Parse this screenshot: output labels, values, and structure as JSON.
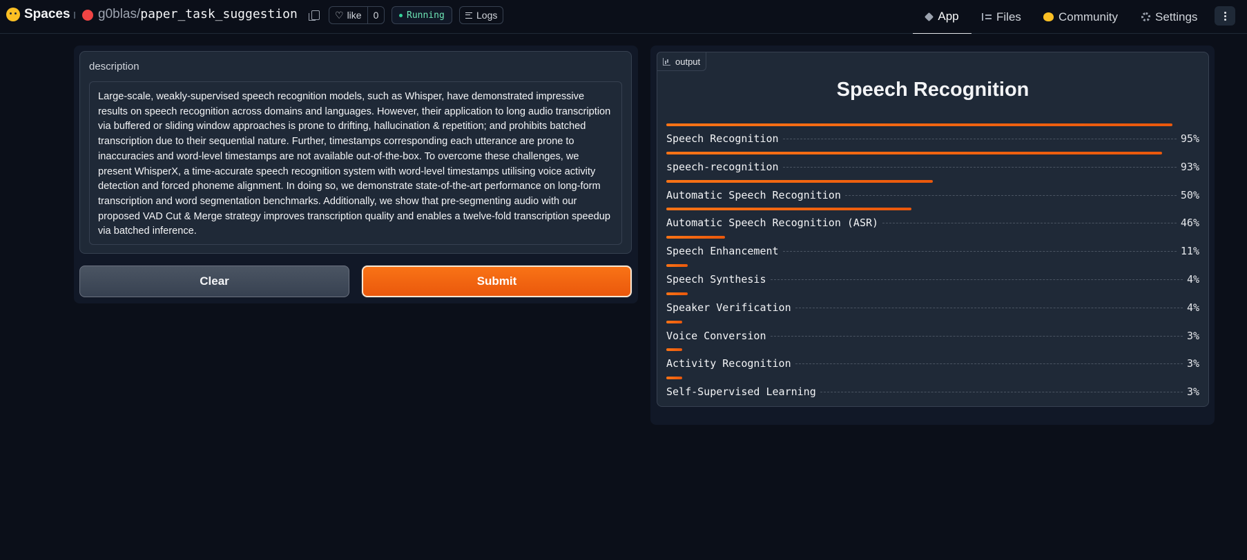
{
  "header": {
    "brand": "Spaces",
    "owner": "g0blas",
    "slash": "/",
    "repo_name": "paper_task_suggestion",
    "like_label": "like",
    "like_count": "0",
    "status": "Running",
    "logs_label": "Logs",
    "nav": {
      "app": "App",
      "files": "Files",
      "community": "Community",
      "settings": "Settings"
    }
  },
  "input": {
    "label": "description",
    "value": "Large-scale, weakly-supervised speech recognition models, such as Whisper, have demonstrated impressive results on speech recognition across domains and languages. However, their application to long audio transcription via buffered or sliding window approaches is prone to drifting, hallucination & repetition; and prohibits batched transcription due to their sequential nature. Further, timestamps corresponding each utterance are prone to inaccuracies and word-level timestamps are not available out-of-the-box. To overcome these challenges, we present WhisperX, a time-accurate speech recognition system with word-level timestamps utilising voice activity detection and forced phoneme alignment. In doing so, we demonstrate state-of-the-art performance on long-form transcription and word segmentation benchmarks. Additionally, we show that pre-segmenting audio with our proposed VAD Cut & Merge strategy improves transcription quality and enables a twelve-fold transcription speedup via batched inference.",
    "clear_label": "Clear",
    "submit_label": "Submit"
  },
  "output": {
    "tag": "output",
    "title": "Speech Recognition",
    "labels": [
      {
        "label": "Speech Recognition",
        "confidence": 0.95,
        "display": "95%"
      },
      {
        "label": "speech-recognition",
        "confidence": 0.93,
        "display": "93%"
      },
      {
        "label": "Automatic Speech Recognition",
        "confidence": 0.5,
        "display": "50%"
      },
      {
        "label": "Automatic Speech Recognition (ASR)",
        "confidence": 0.46,
        "display": "46%"
      },
      {
        "label": "Speech Enhancement",
        "confidence": 0.11,
        "display": "11%"
      },
      {
        "label": "Speech Synthesis",
        "confidence": 0.04,
        "display": "4%"
      },
      {
        "label": "Speaker Verification",
        "confidence": 0.04,
        "display": "4%"
      },
      {
        "label": "Voice Conversion",
        "confidence": 0.03,
        "display": "3%"
      },
      {
        "label": "Activity Recognition",
        "confidence": 0.03,
        "display": "3%"
      },
      {
        "label": "Self-Supervised Learning",
        "confidence": 0.03,
        "display": "3%"
      }
    ]
  },
  "colors": {
    "accent": "#f97316",
    "background": "#0b0f19",
    "panel": "#1f2937",
    "status": "#34d399"
  },
  "icons": [
    "hugging-face-icon",
    "copy-icon",
    "heart-icon",
    "logs-icon",
    "cube-icon",
    "files-icon",
    "community-icon",
    "gear-icon",
    "more-icon",
    "chart-icon"
  ]
}
